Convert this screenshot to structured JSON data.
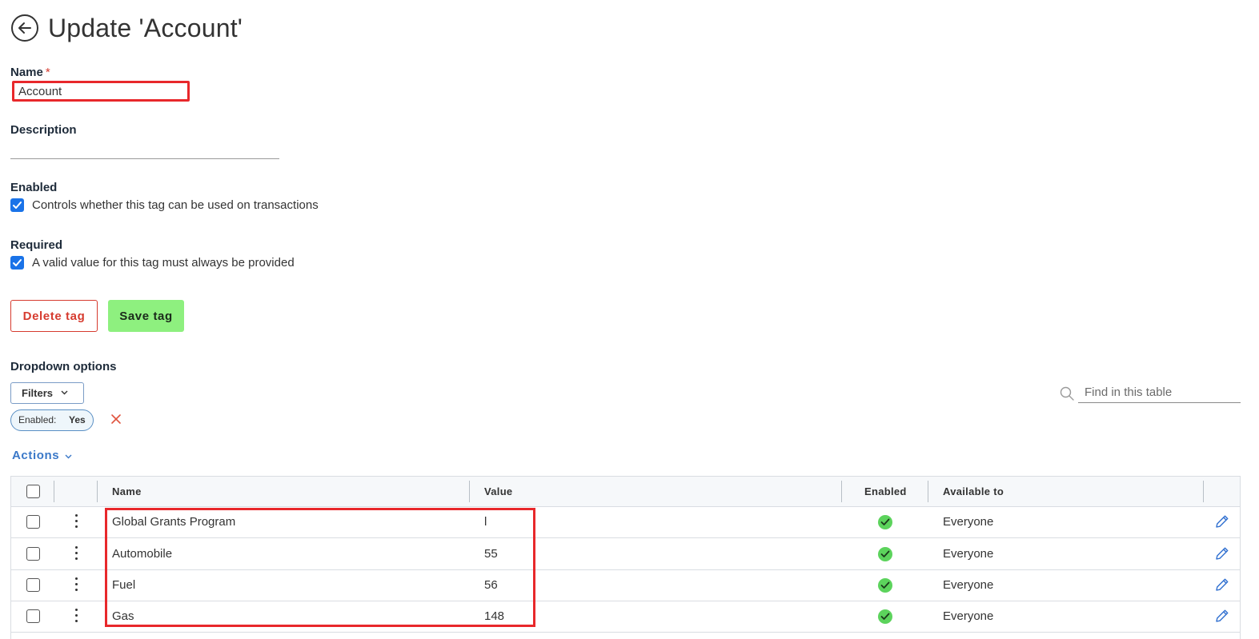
{
  "header": {
    "title": "Update 'Account'"
  },
  "form": {
    "name_label": "Name",
    "required_mark": "*",
    "name_value": "Account",
    "description_label": "Description",
    "description_value": "",
    "enabled_label": "Enabled",
    "enabled_checked": true,
    "enabled_text": "Controls whether this tag can be used on transactions",
    "required_label": "Required",
    "required_checked": true,
    "required_text": "A valid value for this tag must always be provided"
  },
  "buttons": {
    "delete": "Delete tag",
    "save": "Save tag"
  },
  "dropdown": {
    "title": "Dropdown options",
    "filters_label": "Filters",
    "chip_key": "Enabled:",
    "chip_value": "Yes",
    "search_placeholder": "Find in this table",
    "actions_label": "Actions"
  },
  "table": {
    "columns": {
      "name": "Name",
      "value": "Value",
      "enabled": "Enabled",
      "available": "Available to"
    },
    "rows": [
      {
        "name": "Global Grants Program",
        "value": "l",
        "enabled": true,
        "available": "Everyone"
      },
      {
        "name": "Automobile",
        "value": "55",
        "enabled": true,
        "available": "Everyone"
      },
      {
        "name": "Fuel",
        "value": "56",
        "enabled": true,
        "available": "Everyone"
      },
      {
        "name": "Gas",
        "value": "148",
        "enabled": true,
        "available": "Everyone"
      }
    ]
  },
  "colors": {
    "accent_blue": "#1a73e8",
    "link_blue": "#3a78c8",
    "danger_red": "#d63b2f",
    "save_green": "#8ef07f",
    "highlight_red": "#e8282b",
    "enabled_green": "#5cd35c"
  }
}
